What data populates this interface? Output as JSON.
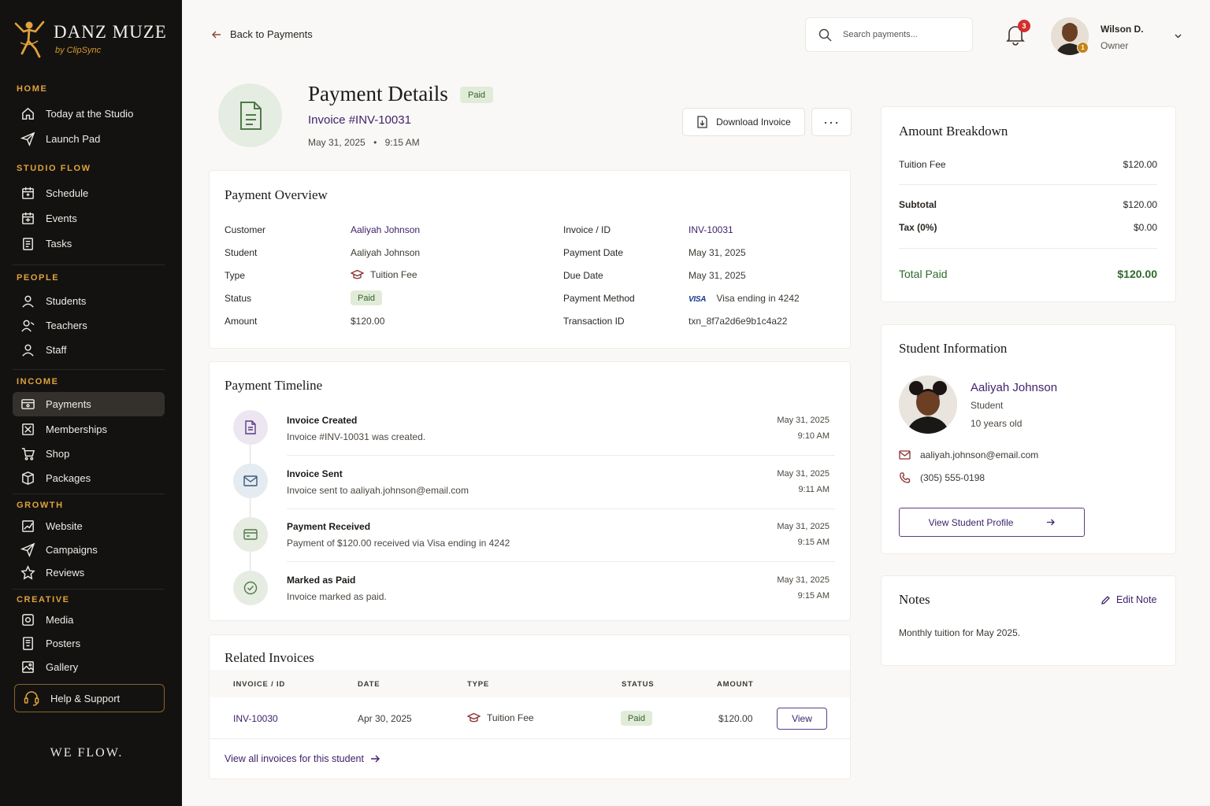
{
  "brand": {
    "name": "DANZ MUZE",
    "sub": "by ClipSync",
    "tagline": "WE FLOW."
  },
  "sidebar": {
    "sections": [
      {
        "title": "HOME",
        "items": [
          "Today at the Studio",
          "Launch Pad"
        ]
      },
      {
        "title": "STUDIO FLOW",
        "items": [
          "Schedule",
          "Events",
          "Tasks"
        ]
      },
      {
        "title": "PEOPLE",
        "items": [
          "Students",
          "Teachers",
          "Staff"
        ]
      },
      {
        "title": "INCOME",
        "items": [
          "Payments",
          "Memberships",
          "Shop",
          "Packages"
        ]
      },
      {
        "title": "GROWTH",
        "items": [
          "Website",
          "Campaigns",
          "Reviews"
        ]
      },
      {
        "title": "CREATIVE",
        "items": [
          "Media",
          "Posters",
          "Gallery"
        ]
      }
    ],
    "active_item": "Payments",
    "help_label": "Help & Support"
  },
  "topbar": {
    "back_label": "Back to Payments",
    "search_placeholder": "Search payments...",
    "notification_count": "3",
    "user": {
      "name": "Wilson D.",
      "role": "Owner",
      "badge": "1"
    }
  },
  "header": {
    "title": "Payment Details",
    "status": "Paid",
    "invoice_label": "Invoice #INV-10031",
    "date": "May 31, 2025",
    "time": "9:15 AM",
    "download_label": "Download Invoice",
    "more_label": "···"
  },
  "overview": {
    "title": "Payment Overview",
    "left": [
      {
        "label": "Customer",
        "value": "Aaliyah Johnson"
      },
      {
        "label": "Student",
        "value": "Aaliyah Johnson"
      },
      {
        "label": "Type",
        "value": "Tuition Fee"
      },
      {
        "label": "Status",
        "value": "Paid"
      },
      {
        "label": "Amount",
        "value": "$120.00"
      }
    ],
    "right": [
      {
        "label": "Invoice / ID",
        "value": "INV-10031"
      },
      {
        "label": "Payment Date",
        "value": "May 31, 2025"
      },
      {
        "label": "Due Date",
        "value": "May 31, 2025"
      },
      {
        "label": "Payment Method",
        "value": "Visa ending in 4242",
        "card_brand": "VISA"
      },
      {
        "label": "Transaction ID",
        "value": "txn_8f7a2d6e9b1c4a22"
      }
    ]
  },
  "timeline": {
    "title": "Payment Timeline",
    "events": [
      {
        "title": "Invoice Created",
        "desc": "Invoice #INV-10031 was created.",
        "date": "May 31, 2025",
        "time": "9:10 AM",
        "icon": "document-icon",
        "color": "#ece6f1"
      },
      {
        "title": "Invoice Sent",
        "desc": "Invoice sent to aaliyah.johnson@email.com",
        "date": "May 31, 2025",
        "time": "9:11 AM",
        "icon": "mail-icon",
        "color": "#e4ebf1"
      },
      {
        "title": "Payment Received",
        "desc": "Payment of $120.00 received via Visa ending in 4242",
        "date": "May 31, 2025",
        "time": "9:15 AM",
        "icon": "card-icon",
        "color": "#e6ece2"
      },
      {
        "title": "Marked as Paid",
        "desc": "Invoice marked as paid.",
        "date": "May 31, 2025",
        "time": "9:15 AM",
        "icon": "check-circle-icon",
        "color": "#e6ece2"
      }
    ]
  },
  "related": {
    "title": "Related Invoices",
    "columns": [
      "INVOICE / ID",
      "DATE",
      "TYPE",
      "STATUS",
      "AMOUNT"
    ],
    "rows": [
      {
        "id": "INV-10030",
        "date": "Apr 30, 2025",
        "type": "Tuition Fee",
        "status": "Paid",
        "amount": "$120.00",
        "action": "View"
      }
    ],
    "view_all_label": "View all invoices for this student"
  },
  "breakdown": {
    "title": "Amount Breakdown",
    "items": [
      {
        "label": "Tuition Fee",
        "value": "$120.00"
      }
    ],
    "subtotal_label": "Subtotal",
    "subtotal": "$120.00",
    "tax_label": "Tax (0%)",
    "tax": "$0.00",
    "total_label": "Total Paid",
    "total": "$120.00"
  },
  "student": {
    "title": "Student Information",
    "name": "Aaliyah Johnson",
    "role": "Student",
    "age": "10 years old",
    "email": "aaliyah.johnson@email.com",
    "phone": "(305) 555-0198",
    "profile_button": "View Student Profile"
  },
  "notes": {
    "title": "Notes",
    "edit_label": "Edit Note",
    "text": "Monthly tuition for May 2025."
  },
  "colors": {
    "accent": "#40226b",
    "gold": "#e0a23c",
    "success": "#2f6a2a",
    "sidebar": "#131211"
  }
}
